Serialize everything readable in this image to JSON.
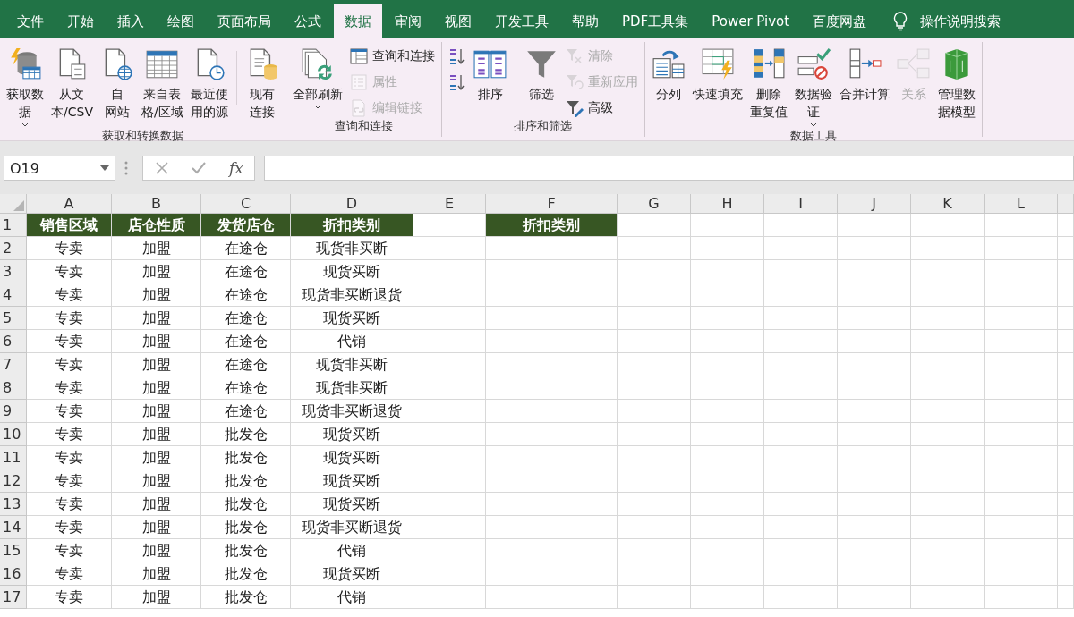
{
  "tabs": [
    {
      "label": "文件",
      "selected": false
    },
    {
      "label": "开始",
      "selected": false
    },
    {
      "label": "插入",
      "selected": false
    },
    {
      "label": "绘图",
      "selected": false
    },
    {
      "label": "页面布局",
      "selected": false
    },
    {
      "label": "公式",
      "selected": false
    },
    {
      "label": "数据",
      "selected": true
    },
    {
      "label": "审阅",
      "selected": false
    },
    {
      "label": "视图",
      "selected": false
    },
    {
      "label": "开发工具",
      "selected": false
    },
    {
      "label": "帮助",
      "selected": false
    },
    {
      "label": "PDF工具集",
      "selected": false
    },
    {
      "label": "Power Pivot",
      "selected": false
    },
    {
      "label": "百度网盘",
      "selected": false
    }
  ],
  "search": {
    "label": "操作说明搜索"
  },
  "ribbon": {
    "groups": [
      {
        "label": "获取和转换数据",
        "items": [
          {
            "kind": "large",
            "label_lines": [
              "获取数",
              "据"
            ],
            "dropdown": true,
            "disabled": false
          },
          {
            "kind": "large",
            "label_lines": [
              "从文",
              "本/CSV"
            ],
            "dropdown": false,
            "disabled": false
          },
          {
            "kind": "large",
            "label_lines": [
              "自",
              "网站"
            ],
            "dropdown": false,
            "disabled": false
          },
          {
            "kind": "large",
            "label_lines": [
              "来自表",
              "格/区域"
            ],
            "dropdown": false,
            "disabled": false
          },
          {
            "kind": "large",
            "label_lines": [
              "最近使",
              "用的源"
            ],
            "dropdown": false,
            "disabled": false
          },
          {
            "kind": "separator"
          },
          {
            "kind": "large",
            "label_lines": [
              "现有",
              "连接"
            ],
            "dropdown": false,
            "disabled": false
          }
        ]
      },
      {
        "label": "查询和连接",
        "items": [
          {
            "kind": "large",
            "label_lines": [
              "全部刷新"
            ],
            "dropdown": true,
            "disabled": false
          },
          {
            "kind": "stack",
            "buttons": [
              {
                "label": "查询和连接",
                "disabled": false
              },
              {
                "label": "属性",
                "disabled": true
              },
              {
                "label": "编辑链接",
                "disabled": true
              }
            ]
          }
        ]
      },
      {
        "label": "排序和筛选",
        "items": [
          {
            "kind": "stack",
            "buttons": [
              {
                "disabled": false
              },
              {
                "disabled": false
              }
            ]
          },
          {
            "kind": "large",
            "label_lines": [
              "排序"
            ],
            "dropdown": false,
            "disabled": false
          },
          {
            "kind": "separator"
          },
          {
            "kind": "large",
            "label_lines": [
              "筛选"
            ],
            "dropdown": false,
            "disabled": false
          },
          {
            "kind": "stack",
            "buttons": [
              {
                "label": "清除",
                "disabled": true
              },
              {
                "label": "重新应用",
                "disabled": true
              },
              {
                "label": "高级",
                "disabled": false
              }
            ]
          }
        ]
      },
      {
        "label": "数据工具",
        "items": [
          {
            "kind": "large",
            "label_lines": [
              "分列"
            ],
            "dropdown": false,
            "disabled": false
          },
          {
            "kind": "large",
            "label_lines": [
              "快速填充"
            ],
            "dropdown": false,
            "disabled": false
          },
          {
            "kind": "large",
            "label_lines": [
              "删除",
              "重复值"
            ],
            "dropdown": false,
            "disabled": false
          },
          {
            "kind": "large",
            "label_lines": [
              "数据验",
              "证"
            ],
            "dropdown": true,
            "disabled": false
          },
          {
            "kind": "large",
            "label_lines": [
              "合并计算"
            ],
            "dropdown": false,
            "disabled": false
          },
          {
            "kind": "large",
            "label_lines": [
              "关系"
            ],
            "dropdown": false,
            "disabled": true
          },
          {
            "kind": "large",
            "label_lines": [
              "管理数",
              "据模型"
            ],
            "dropdown": false,
            "disabled": false
          }
        ]
      }
    ]
  },
  "formula_bar": {
    "name_box": "O19",
    "function_label": "fx"
  },
  "sheet": {
    "columns": [
      "A",
      "B",
      "C",
      "D",
      "E",
      "F",
      "G",
      "H",
      "I",
      "J",
      "K",
      "L"
    ],
    "rows": [
      {
        "number": "1",
        "header": true,
        "cells": {
          "A": "销售区域",
          "B": "店仓性质",
          "C": "发货店仓",
          "D": "折扣类别",
          "F": "折扣类别"
        }
      },
      {
        "number": "2",
        "header": false,
        "cells": {
          "A": "专卖",
          "B": "加盟",
          "C": "在途仓",
          "D": "现货非买断"
        }
      },
      {
        "number": "3",
        "header": false,
        "cells": {
          "A": "专卖",
          "B": "加盟",
          "C": "在途仓",
          "D": "现货买断"
        }
      },
      {
        "number": "4",
        "header": false,
        "cells": {
          "A": "专卖",
          "B": "加盟",
          "C": "在途仓",
          "D": "现货非买断退货"
        }
      },
      {
        "number": "5",
        "header": false,
        "cells": {
          "A": "专卖",
          "B": "加盟",
          "C": "在途仓",
          "D": "现货买断"
        }
      },
      {
        "number": "6",
        "header": false,
        "cells": {
          "A": "专卖",
          "B": "加盟",
          "C": "在途仓",
          "D": "代销"
        }
      },
      {
        "number": "7",
        "header": false,
        "cells": {
          "A": "专卖",
          "B": "加盟",
          "C": "在途仓",
          "D": "现货非买断"
        }
      },
      {
        "number": "8",
        "header": false,
        "cells": {
          "A": "专卖",
          "B": "加盟",
          "C": "在途仓",
          "D": "现货非买断"
        }
      },
      {
        "number": "9",
        "header": false,
        "cells": {
          "A": "专卖",
          "B": "加盟",
          "C": "在途仓",
          "D": "现货非买断退货"
        }
      },
      {
        "number": "10",
        "header": false,
        "cells": {
          "A": "专卖",
          "B": "加盟",
          "C": "批发仓",
          "D": "现货买断"
        }
      },
      {
        "number": "11",
        "header": false,
        "cells": {
          "A": "专卖",
          "B": "加盟",
          "C": "批发仓",
          "D": "现货买断"
        }
      },
      {
        "number": "12",
        "header": false,
        "cells": {
          "A": "专卖",
          "B": "加盟",
          "C": "批发仓",
          "D": "现货买断"
        }
      },
      {
        "number": "13",
        "header": false,
        "cells": {
          "A": "专卖",
          "B": "加盟",
          "C": "批发仓",
          "D": "现货买断"
        }
      },
      {
        "number": "14",
        "header": false,
        "cells": {
          "A": "专卖",
          "B": "加盟",
          "C": "批发仓",
          "D": "现货非买断退货"
        }
      },
      {
        "number": "15",
        "header": false,
        "cells": {
          "A": "专卖",
          "B": "加盟",
          "C": "批发仓",
          "D": "代销"
        }
      },
      {
        "number": "16",
        "header": false,
        "cells": {
          "A": "专卖",
          "B": "加盟",
          "C": "批发仓",
          "D": "现货买断"
        }
      },
      {
        "number": "17",
        "header": false,
        "cells": {
          "A": "专卖",
          "B": "加盟",
          "C": "批发仓",
          "D": "代销"
        }
      }
    ]
  }
}
